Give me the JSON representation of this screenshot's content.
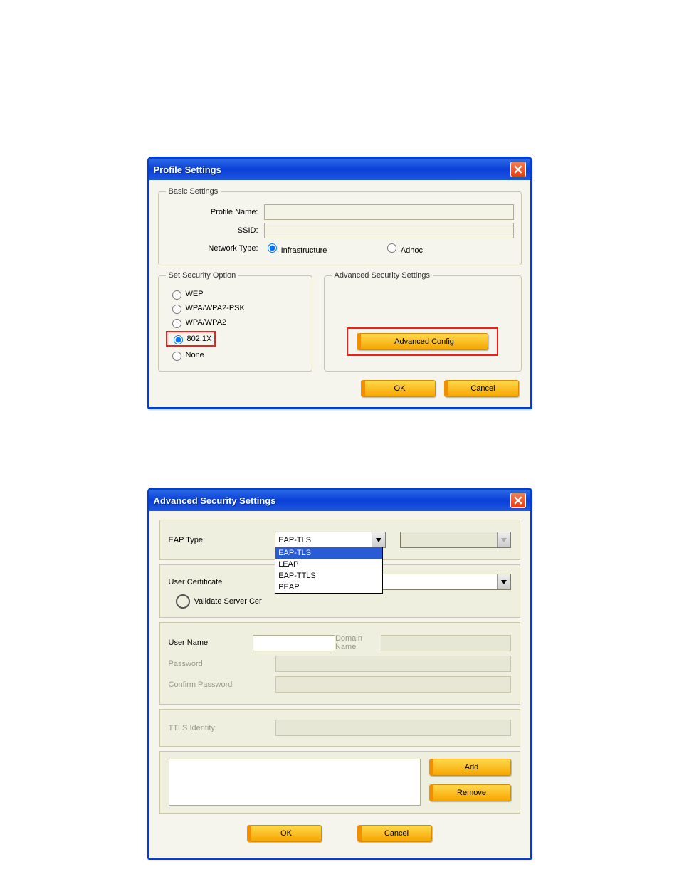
{
  "dialog1": {
    "title": "Profile Settings",
    "basic": {
      "legend": "Basic Settings",
      "profile_name_label": "Profile Name:",
      "profile_name_value": "",
      "ssid_label": "SSID:",
      "ssid_value": "",
      "network_type_label": "Network Type:",
      "radio_infra": "Infrastructure",
      "radio_adhoc": "Adhoc"
    },
    "security": {
      "legend": "Set Security Option",
      "opt_wep": "WEP",
      "opt_wpapsk": "WPA/WPA2-PSK",
      "opt_wpa": "WPA/WPA2",
      "opt_8021x": "802.1X",
      "opt_none": "None"
    },
    "advanced": {
      "legend": "Advanced Security Settings",
      "btn": "Advanced Config"
    },
    "ok": "OK",
    "cancel": "Cancel"
  },
  "dialog2": {
    "title": "Advanced Security Settings",
    "eap_type_label": "EAP Type:",
    "eap_type_value": "EAP-TLS",
    "eap_options": [
      "EAP-TLS",
      "LEAP",
      "EAP-TTLS",
      "PEAP"
    ],
    "user_cert_label": "User Certificate",
    "validate_label": "Validate Server Certificate",
    "validate_label_trunc": "Validate Server Cer",
    "user_name_label": "User Name",
    "domain_name_label": "Domain Name",
    "password_label": "Password",
    "confirm_password_label": "Confirm Password",
    "ttls_identity_label": "TTLS Identity",
    "add": "Add",
    "remove": "Remove",
    "ok": "OK",
    "cancel": "Cancel"
  }
}
